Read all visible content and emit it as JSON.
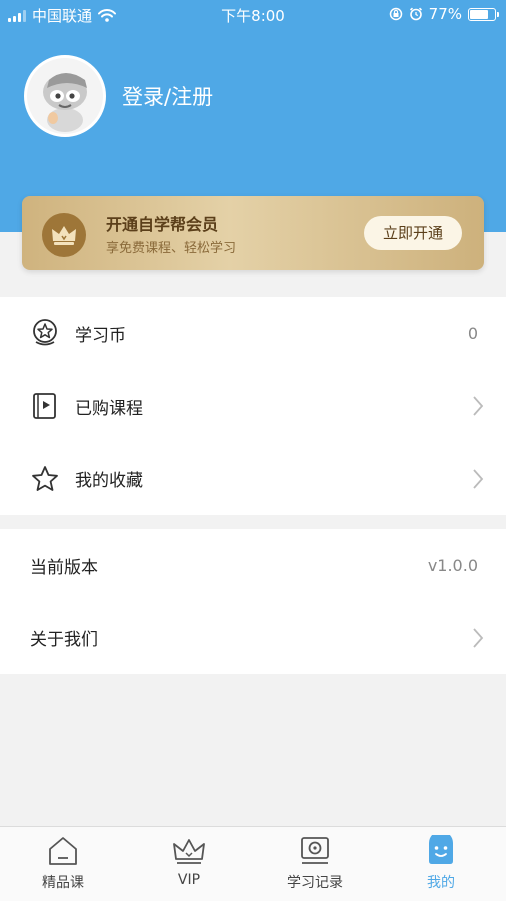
{
  "status": {
    "carrier": "中国联通",
    "time": "下午8:00",
    "battery": "77%",
    "battery_level": 0.77
  },
  "profile": {
    "login_label": "登录/注册"
  },
  "vip": {
    "title": "开通自学帮会员",
    "subtitle": "享免费课程、轻松学习",
    "button": "立即开通"
  },
  "menu": {
    "items": [
      {
        "label": "学习币",
        "value": "0",
        "icon": "coin-star-icon"
      },
      {
        "label": "已购课程",
        "icon": "book-icon"
      },
      {
        "label": "我的收藏",
        "icon": "star-icon"
      }
    ]
  },
  "info": {
    "items": [
      {
        "label": "当前版本",
        "value": "v1.0.0"
      },
      {
        "label": "关于我们"
      }
    ]
  },
  "tabs": [
    {
      "label": "精品课",
      "icon": "home-icon"
    },
    {
      "label": "VIP",
      "icon": "crown-icon"
    },
    {
      "label": "学习记录",
      "icon": "record-icon"
    },
    {
      "label": "我的",
      "icon": "profile-face-icon",
      "active": true
    }
  ],
  "colors": {
    "primary": "#4fa8e6",
    "gold": "#cfb37e",
    "gold_dark": "#9e7638"
  }
}
